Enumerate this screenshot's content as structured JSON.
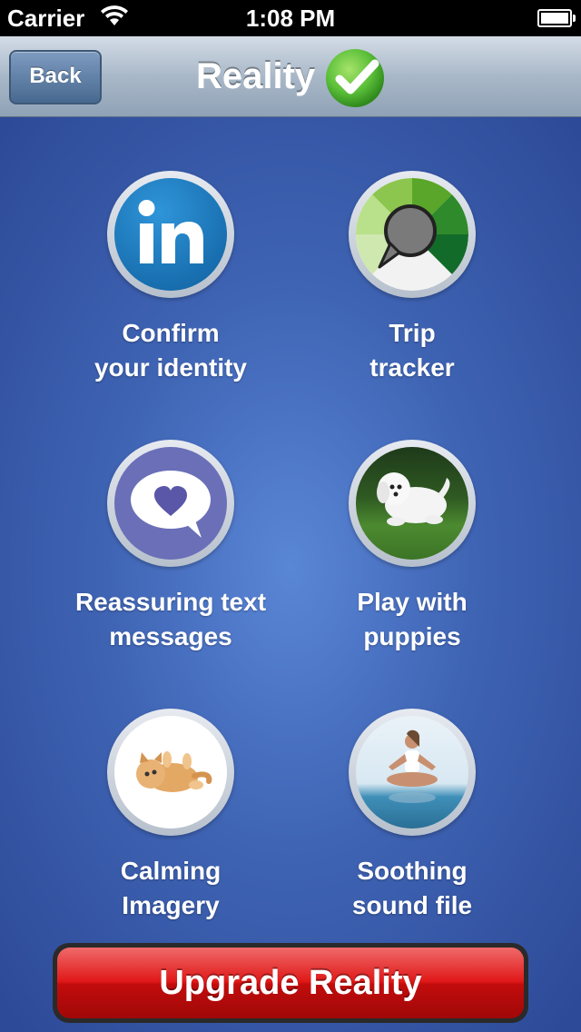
{
  "status_bar": {
    "carrier": "Carrier",
    "time": "1:08 PM"
  },
  "nav": {
    "back_label": "Back",
    "title": "Reality"
  },
  "tiles": [
    {
      "line1": "Confirm",
      "line2": "your identity",
      "icon": "linkedin-icon"
    },
    {
      "line1": "Trip",
      "line2": "tracker",
      "icon": "gauge-icon"
    },
    {
      "line1": "Reassuring text",
      "line2": "messages",
      "icon": "heart-bubble-icon"
    },
    {
      "line1": "Play with",
      "line2": "puppies",
      "icon": "puppy-photo"
    },
    {
      "line1": "Calming",
      "line2": "Imagery",
      "icon": "kitten-photo"
    },
    {
      "line1": "Soothing",
      "line2": "sound file",
      "icon": "meditation-photo"
    }
  ],
  "upgrade_button": {
    "label": "Upgrade Reality"
  },
  "colors": {
    "accent_red": "#e01818",
    "background_blue": "#3f64b4",
    "check_green": "#5cc03a",
    "linkedin_blue": "#1b75b8",
    "bubble_purple": "#6a6fb8"
  }
}
